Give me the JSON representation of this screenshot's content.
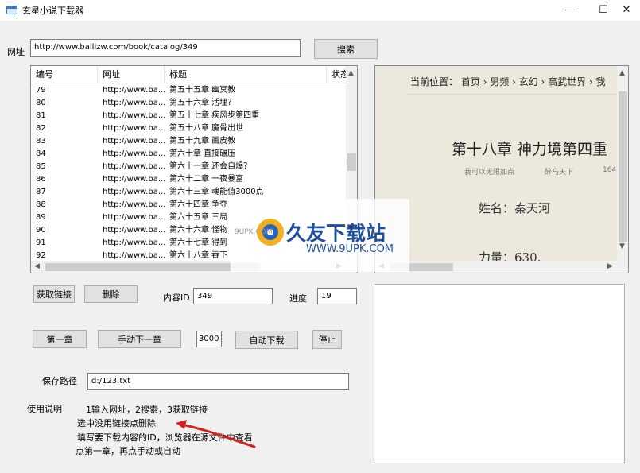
{
  "window": {
    "title": "玄星小说下载器",
    "min_glyph": "—",
    "max_glyph": "☐",
    "close_glyph": "✕"
  },
  "url_label": "网址",
  "url_value": "http://www.bailizw.com/book/catalog/349",
  "search_label": "搜索",
  "list": {
    "columns": [
      "编号",
      "网址",
      "标题",
      "状态"
    ],
    "rows": [
      {
        "num": "79",
        "url": "http://www.ba...",
        "title": "第五十五章 幽冥教"
      },
      {
        "num": "80",
        "url": "http://www.ba...",
        "title": "第五十六章 活埋？"
      },
      {
        "num": "81",
        "url": "http://www.ba...",
        "title": "第五十七章 疾风步第四重"
      },
      {
        "num": "82",
        "url": "http://www.ba...",
        "title": "第五十八章 魔骨出世"
      },
      {
        "num": "83",
        "url": "http://www.ba...",
        "title": "第五十九章 画皮教"
      },
      {
        "num": "84",
        "url": "http://www.ba...",
        "title": "第六十章 直接碾压"
      },
      {
        "num": "85",
        "url": "http://www.ba...",
        "title": "第六十一章 还会自爆？"
      },
      {
        "num": "86",
        "url": "http://www.ba...",
        "title": "第六十二章 一夜暴富"
      },
      {
        "num": "87",
        "url": "http://www.ba...",
        "title": "第六十三章 魂能值3000点"
      },
      {
        "num": "88",
        "url": "http://www.ba...",
        "title": "第六十四章 争夺"
      },
      {
        "num": "89",
        "url": "http://www.ba...",
        "title": "第六十五章 三局"
      },
      {
        "num": "90",
        "url": "http://www.ba...",
        "title": "第六十六章 怪物"
      },
      {
        "num": "91",
        "url": "http://www.ba...",
        "title": "第六十七章 得到"
      },
      {
        "num": "92",
        "url": "http://www.ba...",
        "title": "第六十八章 吞下"
      }
    ]
  },
  "browser": {
    "breadcrumb": "当前位置： 首页 › 男频 › 玄幻 › 高武世界 › 我",
    "chapter_title": "第十八章 神力境第四重",
    "meta1": "我可以无限加点",
    "meta2": "醉马天下",
    "meta3": "164",
    "stat1": "姓名：秦天河",
    "stat2": "力量：630."
  },
  "watermark": {
    "text": "久友下载站",
    "url": "WWW.9UPK.COM",
    "side": "9UPK.COM"
  },
  "buttons": {
    "get_links": "获取链接",
    "delete": "删除",
    "first_chapter": "第一章",
    "manual_next": "手动下一章",
    "auto_download": "自动下载",
    "stop": "停止"
  },
  "content_id_label": "内容ID",
  "content_id_value": "349",
  "progress_label": "进度",
  "progress_value": "19",
  "interval_value": "3000",
  "save_path_label": "保存路径",
  "save_path_value": "d:/123.txt",
  "instructions_label": "使用说明",
  "instructions": [
    "1输入网址，2搜索，3获取链接",
    "选中没用链接点删除",
    "填写要下载内容的ID，浏览器在源文件中查看",
    "点第一章，再点手动或自动"
  ],
  "colors": {
    "annotation_arrow": "#d42020",
    "watermark_blue": "#1f4f9c",
    "browser_bg": "#ede8dc"
  }
}
